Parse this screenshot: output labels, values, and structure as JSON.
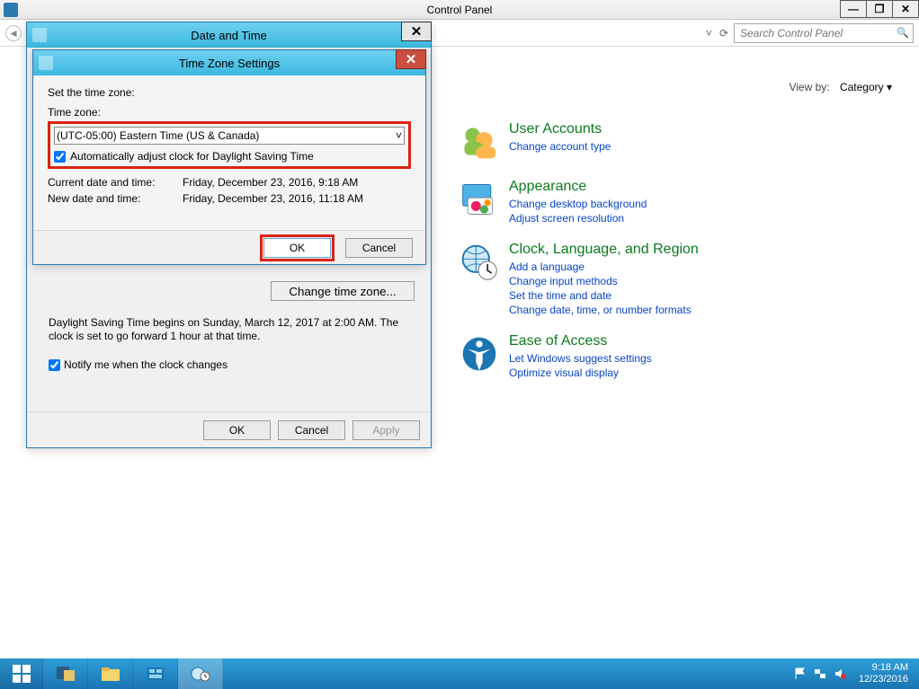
{
  "controlPanel": {
    "windowTitle": "Control Panel",
    "searchPlaceholder": "Search Control Panel",
    "minimize": "—",
    "maximize": "❐",
    "close": "✕",
    "viewByLabel": "View by:",
    "viewByValue": "Category ▾",
    "dropdownGlyph": "˅",
    "refreshGlyph": "⟳",
    "searchGlyph": "🔍"
  },
  "categories": {
    "userAccounts": {
      "title": "User Accounts",
      "link1": "Change account type"
    },
    "appearance": {
      "title": "Appearance",
      "link1": "Change desktop background",
      "link2": "Adjust screen resolution"
    },
    "region": {
      "title": "Clock, Language, and Region",
      "link1": "Add a language",
      "link2": "Change input methods",
      "link3": "Set the time and date",
      "link4": "Change date, time, or number formats"
    },
    "ease": {
      "title": "Ease of Access",
      "link1": "Let Windows suggest settings",
      "link2": "Optimize visual display"
    }
  },
  "dateTimeDialog": {
    "title": "Date and Time",
    "close": "✕",
    "changeTimeZoneBtn": "Change time zone...",
    "dstText": "Daylight Saving Time begins on Sunday, March 12, 2017 at 2:00 AM. The clock is set to go forward 1 hour at that time.",
    "notifyLabel": "Notify me when the clock changes",
    "ok": "OK",
    "cancel": "Cancel",
    "apply": "Apply"
  },
  "timeZoneDialog": {
    "title": "Time Zone Settings",
    "close": "✕",
    "setLabel": "Set the time zone:",
    "tzLabel": "Time zone:",
    "tzSelected": "(UTC-05:00) Eastern Time (US & Canada)",
    "tzDrop": "˅",
    "autoDstLabel": "Automatically adjust clock for Daylight Saving Time",
    "curLabel": "Current date and time:",
    "curValue": "Friday, December 23, 2016, 9:18 AM",
    "newLabel": "New date and time:",
    "newValue": "Friday, December 23, 2016, 11:18 AM",
    "ok": "OK",
    "cancel": "Cancel"
  },
  "taskbar": {
    "time": "9:18 AM",
    "date": "12/23/2016"
  }
}
